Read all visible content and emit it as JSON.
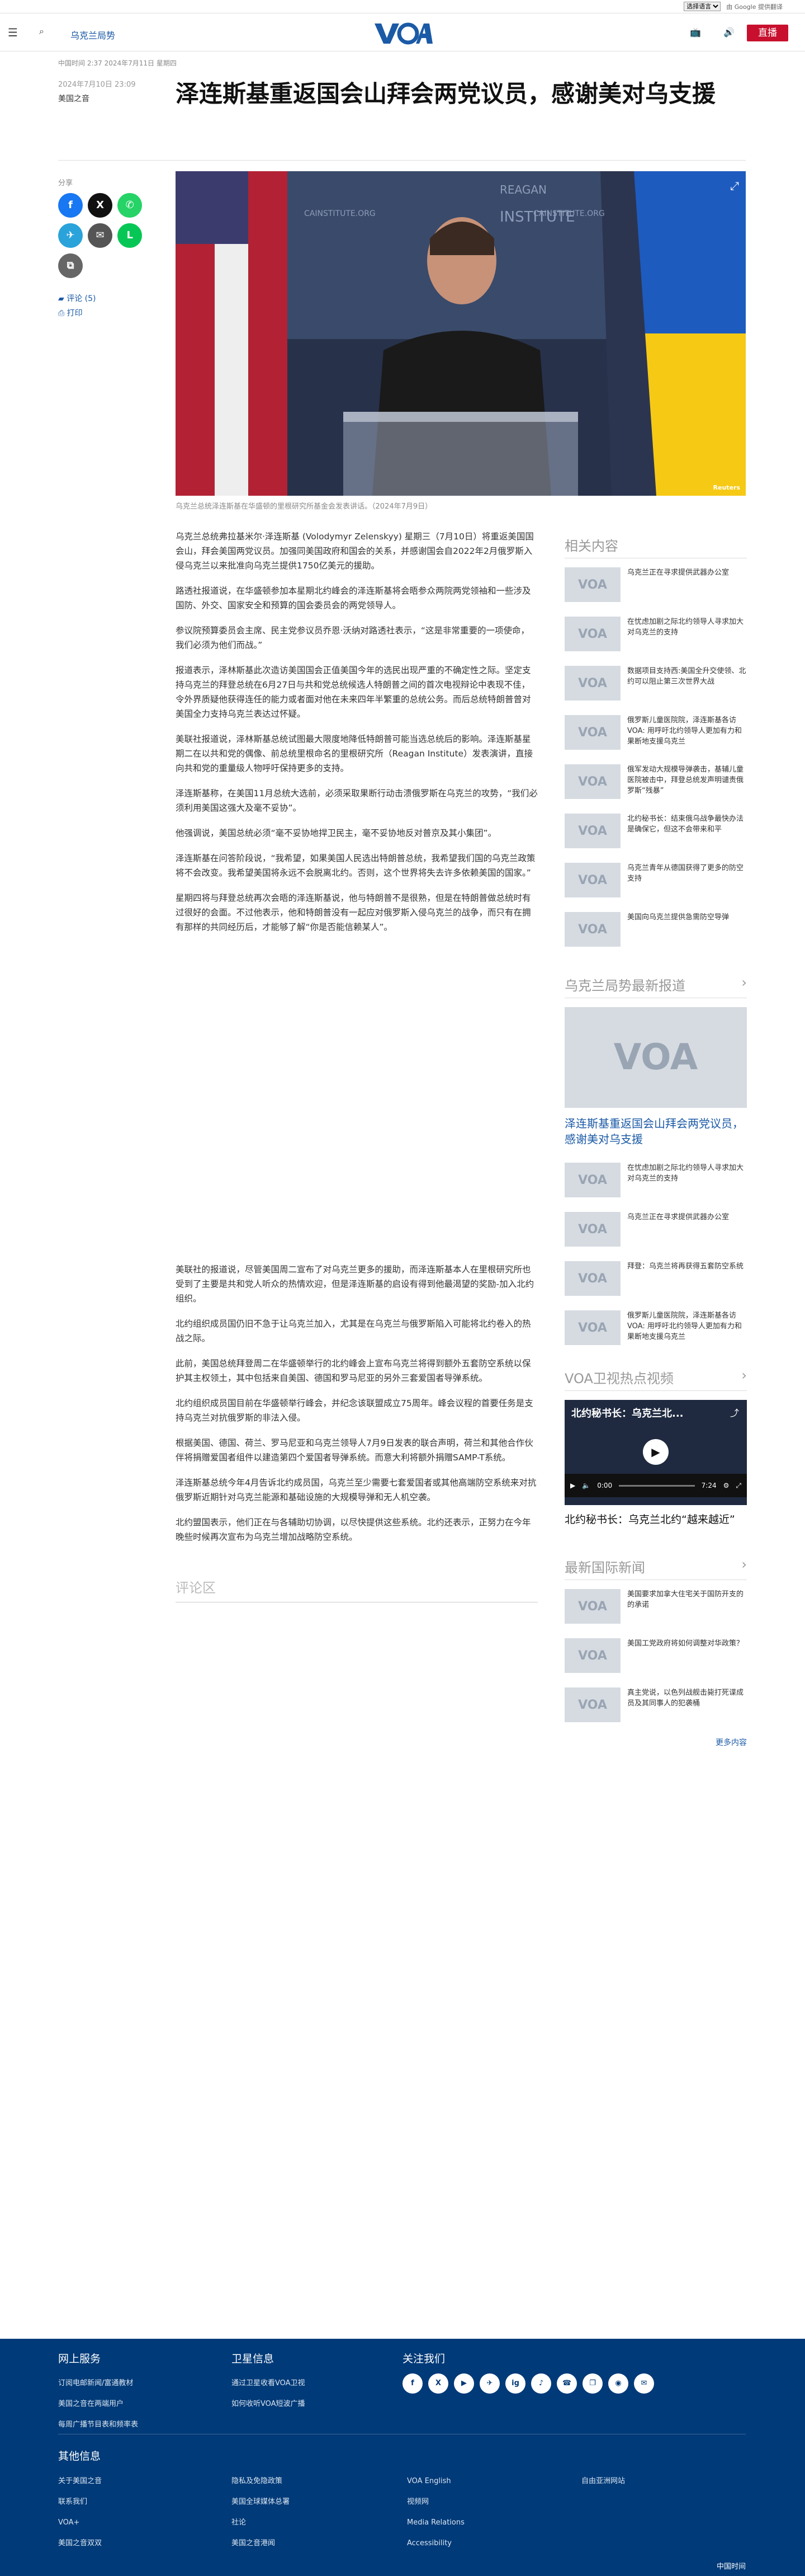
{
  "topbar": {
    "lang_select": "选择语言",
    "translate": "由 Google 提供翻译"
  },
  "header": {
    "section": "乌克兰局势",
    "live": "直播"
  },
  "meta": "中国时间 2:37 2024年7月11日 星期四",
  "byline": {
    "date": "2024年7月10日 23:09",
    "author": "美国之音"
  },
  "title": "泽连斯基重返国会山拜会两党议员，感谢美对乌支援",
  "share": {
    "label": "分享",
    "comments": "评论 (5)",
    "print": "打印"
  },
  "hero": {
    "credit": "Reuters",
    "backdrop_left": "REAGAN INSTITUTE",
    "backdrop_right": "CAINSTITUTE.ORG"
  },
  "caption": "乌克兰总统泽连斯基在华盛顿的里根研究所基金会发表讲话。（2024年7月9日）",
  "body": [
    "乌克兰总统弗拉基米尔·泽连斯基 (Volodymyr Zelenskyy) 星期三（7月10日）将重返美国国会山，拜会美国两党议员。加强同美国政府和国会的关系，并感谢国会自2022年2月俄罗斯入侵乌克兰以来批准向乌克兰提供1750亿美元的援助。",
    "路透社报道说，在华盛顿参加本星期北约峰会的泽连斯基将会晤参众两院两党领袖和一些涉及国防、外交、国家安全和预算的国会委员会的两党领导人。",
    "参议院预算委员会主席、民主党参议员乔恩·沃纳对路透社表示，“这是非常重要的一项使命，我们必须为他们而战。”",
    "报道表示，泽林斯基此次造访美国国会正值美国今年的选民出现严重的不确定性之际。坚定支持乌克兰的拜登总统在6月27日与共和党总统候选人特朗普之间的首次电视辩论中表现不佳，令外界质疑他获得连任的能力或者面对他在未来四年半繁重的总统公务。而后总统特朗普曾对美国全力支持乌克兰表达过怀疑。",
    "美联社报道说，泽林斯基总统试图最大限度地降低特朗普可能当选总统后的影响。泽连斯基星期二在以共和党的偶像、前总统里根命名的里根研究所（Reagan Institute）发表演讲，直接向共和党的重量级人物呼吁保持更多的支持。",
    "泽连斯基称，在美国11月总统大选前，必须采取果断行动击溃俄罗斯在乌克兰的攻势，“我们必须利用美国这强大及毫不妥协”。",
    "他强调说，美国总统必须“毫不妥协地捍卫民主，毫不妥协地反对普京及其小集团”。",
    "泽连斯基在问答阶段说，“我希望，如果美国人民选出特朗普总统，我希望我们国的乌克兰政策将不会改变。我希望美国将永远不会脱离北约。否则，这个世界将失去许多依赖美国的国家。”",
    "星期四将与拜登总统再次会晤的泽连斯基说，他与特朗普不是很熟，但是在特朗普做总统时有过很好的会面。不过他表示，他和特朗普没有一起应对俄罗斯入侵乌克兰的战争，而只有在拥有那样的共同经历后，才能够了解“你是否能信赖某人”。"
  ],
  "body2": [
    "美联社的报道说，尽管美国周二宣布了对乌克兰更多的援助，而泽连斯基本人在里根研究所也受到了主要是共和党人听众的热情欢迎，但是泽连斯基的启设有得到他最渴望的奖励-加入北约组织。",
    "北约组织成员国仍旧不急于让乌克兰加入，尤其是在乌克兰与俄罗斯陷入可能将北约卷入的热战之际。",
    "此前，美国总统拜登周二在华盛顿举行的北约峰会上宣布乌克兰将得到额外五套防空系统以保护其主权领土，其中包括来自美国、德国和罗马尼亚的另外三套爱国者导弹系统。",
    "北约组织成员国目前在华盛顿举行峰会，并纪念该联盟成立75周年。峰会议程的首要任务是支持乌克兰对抗俄罗斯的非法入侵。",
    "根据美国、德国、荷兰、罗马尼亚和乌克兰领导人7月9日发表的联合声明，荷兰和其他合作伙伴将捐赠爱国者组件以建造第四个爱国者导弹系统。而意大利将额外捐赠SAMP-T系统。",
    "泽连斯基总统今年4月告诉北约成员国，乌克兰至少需要七套爱国者或其他高端防空系统来对抗俄罗斯近期针对乌克兰能源和基础设施的大规模导弹和无人机空袭。",
    "北约盟国表示，他们正在与各辅助切协调，以尽快提供这些系统。北约还表示，正努力在今年晚些时候再次宣布为乌克兰增加战略防空系统。"
  ],
  "comments_label": "评论区",
  "related": {
    "heading": "相关内容",
    "items": [
      "乌克兰正在寻求提供武器办公室",
      "在忧虑加剧之际北约领导人寻求加大对乌克兰的支持",
      "数据项目支持西:美国全升交使领、北约可以阻止第三次世界大战",
      "俄罗斯儿童医院院，泽连斯基各访VOA: 用呼吁北约领导人更加有力和果断地支援乌克兰",
      "俄军发动大规模导弹袭击，基辅儿童医院被击中，拜登总统发声明谴责俄罗斯“残暴”",
      "北约秘书长：结束俄乌战争最快办法是确保它，但这不会带来和平",
      "乌克兰青年从德国获得了更多的防空支持",
      "美国向乌克兰提供急需防空导弹"
    ]
  },
  "latest": {
    "heading": "乌克兰局势最新报道",
    "featured": "泽连斯基重返国会山拜会两党议员，感谢美对乌支援",
    "items": [
      "在忧虑加剧之际北约领导人寻求加大对乌克兰的支持",
      "乌克兰正在寻求提供武器办公室",
      "拜登：乌克兰将再获得五套防空系统",
      "俄罗斯儿童医院院，泽连斯基各访VOA: 用呼吁北约领导人更加有力和果断地支援乌克兰"
    ]
  },
  "video": {
    "heading": "VOA卫视热点视频",
    "overlay": "北约秘书长：乌克兰北...",
    "title": "北约秘书长：乌克兰北约“越来越近”",
    "time_current": "0:00",
    "time_total": "7:24"
  },
  "intl": {
    "heading": "最新国际新闻",
    "items": [
      "美国要求加拿大住宅关于国防开支的的承诺",
      "美国工党政府将如何调整对华政策？",
      "真主党说，以色列战舰击毙打死谍成员及其同事人的犯袭桶"
    ],
    "more": "更多内容"
  },
  "footer": {
    "col1_head": "网上服务",
    "col1": [
      "订阅电邮新闻/富通教材",
      "美国之音在两端用户",
      "每周广播节目表和频率表"
    ],
    "col2_head": "卫星信息",
    "col2": [
      "通过卫星收看VOA卫视",
      "如何收听VOA短波广播"
    ],
    "col3_head": "关注我们",
    "social": [
      "f",
      "X",
      "▶",
      "✈",
      "ig",
      "♪",
      "☎",
      "❐",
      "◉",
      "✉"
    ],
    "other_head": "其他信息",
    "links": [
      [
        "关于美国之音",
        "隐私及免隐政策",
        "VOA English",
        "自由亚洲网站"
      ],
      [
        "联系我们",
        "美国全球媒体总署",
        "视频网",
        ""
      ],
      [
        "VOA+",
        "社论",
        "Media Relations",
        ""
      ],
      [
        "美国之音双双",
        "美国之音港闻",
        "Accessibility",
        ""
      ]
    ],
    "lang": "中国时间"
  }
}
